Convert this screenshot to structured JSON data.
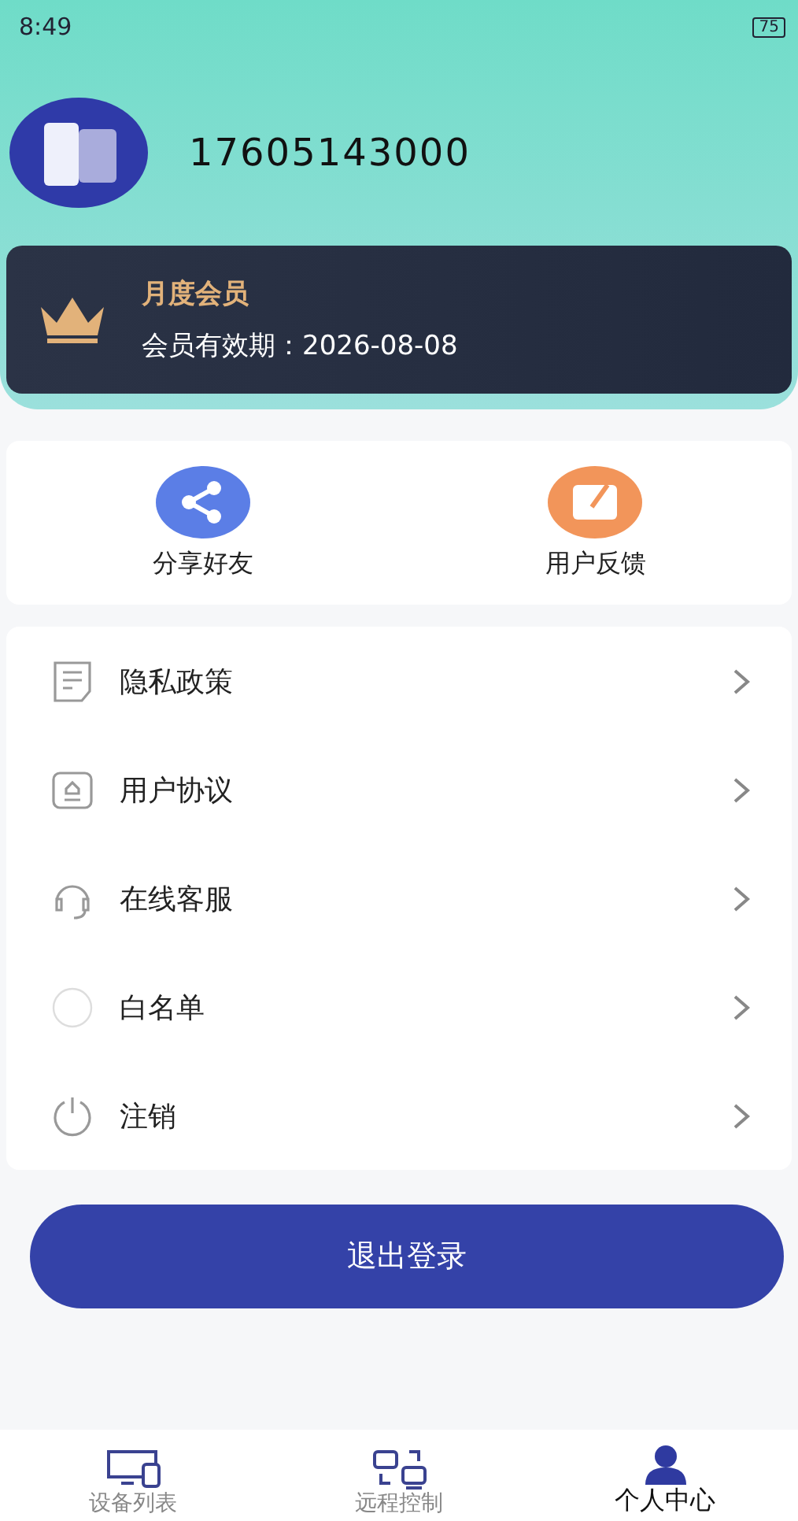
{
  "status_bar": {
    "time": "8:49",
    "battery": "75"
  },
  "profile": {
    "phone": "17605143000"
  },
  "membership": {
    "title": "月度会员",
    "expiry": "会员有效期：2026-08-08"
  },
  "actions": [
    {
      "kind": "share",
      "label": "分享好友"
    },
    {
      "kind": "feedback",
      "label": "用户反馈"
    }
  ],
  "menu": [
    {
      "kind": "document",
      "label": "隐私政策"
    },
    {
      "kind": "agreement",
      "label": "用户协议"
    },
    {
      "kind": "headset",
      "label": "在线客服"
    },
    {
      "kind": "circle",
      "label": "白名单"
    },
    {
      "kind": "power",
      "label": "注销"
    }
  ],
  "logout_button": "退出登录",
  "tabs": [
    {
      "kind": "devices",
      "label": "设备列表",
      "selected": false
    },
    {
      "kind": "remote",
      "label": "远程控制",
      "selected": false
    },
    {
      "kind": "person",
      "label": "个人中心",
      "selected": true
    }
  ]
}
